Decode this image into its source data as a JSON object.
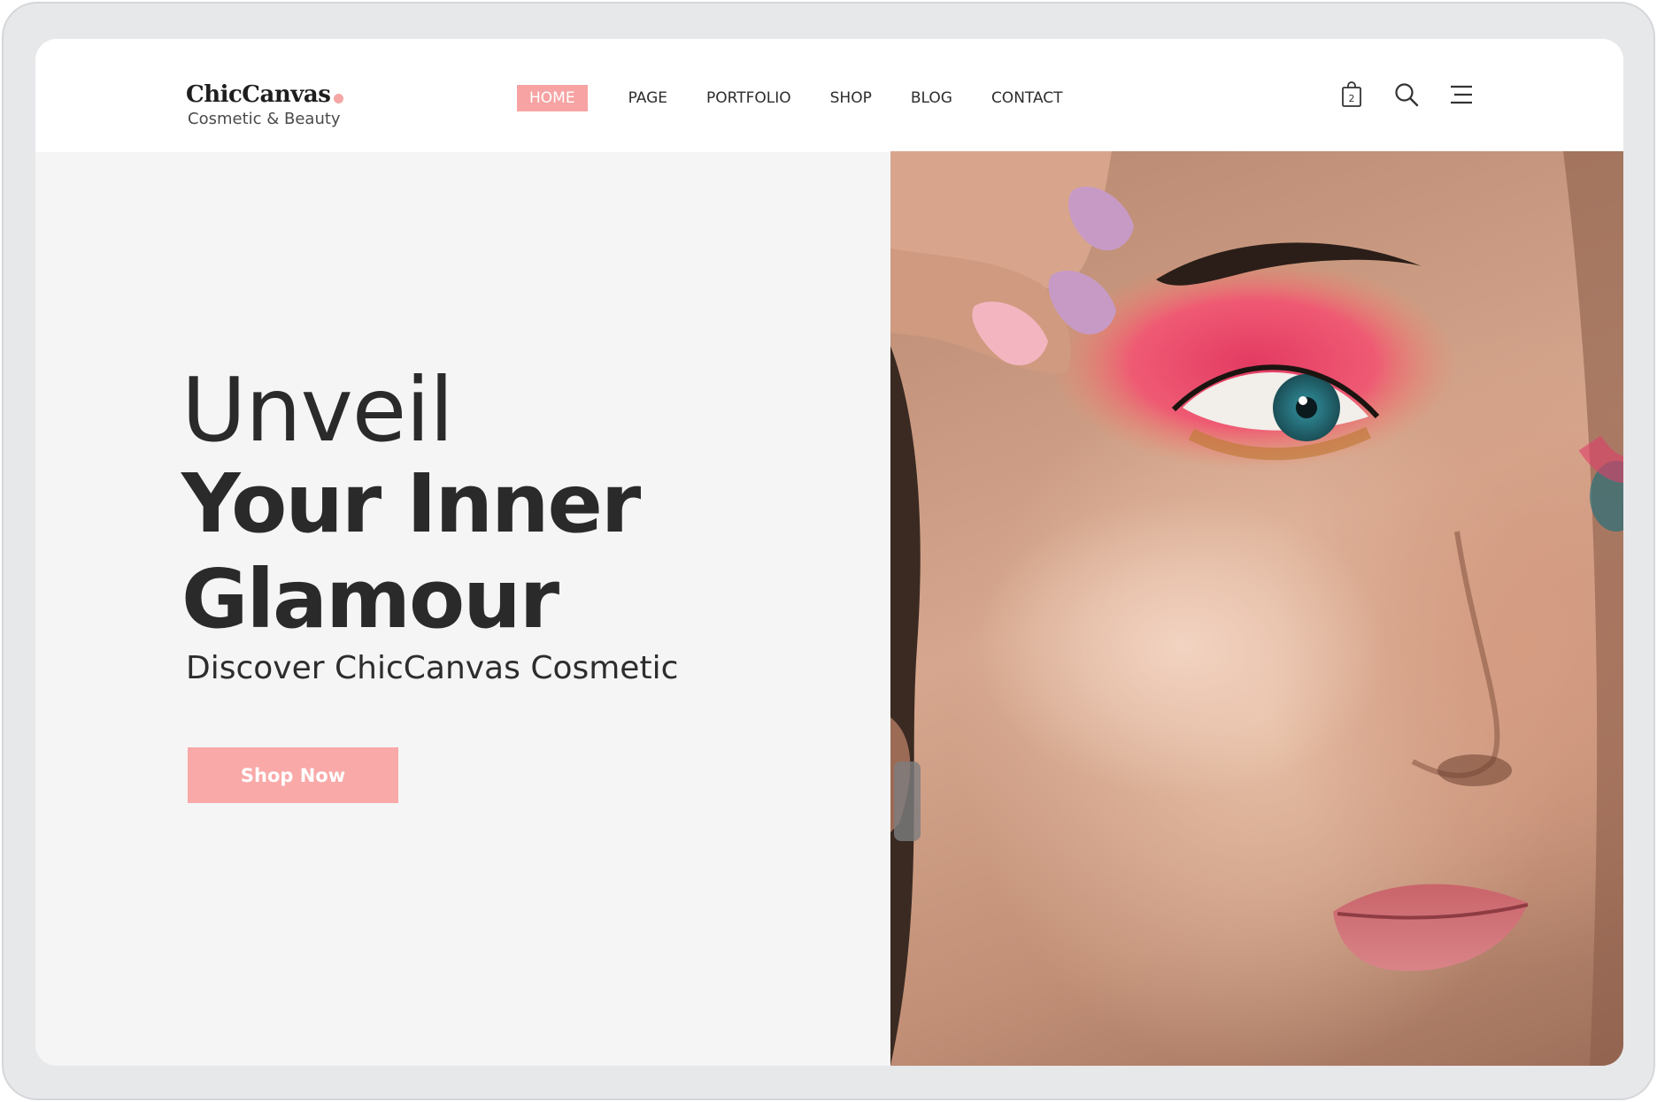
{
  "brand": {
    "name": "ChicCanvas",
    "tagline": "Cosmetic & Beauty",
    "accent_color": "#f7a3a3"
  },
  "nav": {
    "items": [
      {
        "label": "HOME",
        "active": true
      },
      {
        "label": "PAGE",
        "active": false
      },
      {
        "label": "PORTFOLIO",
        "active": false
      },
      {
        "label": "SHOP",
        "active": false
      },
      {
        "label": "BLOG",
        "active": false
      },
      {
        "label": "CONTACT",
        "active": false
      }
    ]
  },
  "header_icons": {
    "cart_icon": "shopping-bag-icon",
    "cart_count": "2",
    "search_icon": "search-icon",
    "menu_icon": "hamburger-menu-icon"
  },
  "hero": {
    "headline_light": "Unveil",
    "headline_bold_line1": "Your Inner",
    "headline_bold_line2": "Glamour",
    "subtitle": "Discover ChicCanvas Cosmetic",
    "cta_label": "Shop Now",
    "image": "close-up portrait of woman with pink eyeshadow"
  }
}
